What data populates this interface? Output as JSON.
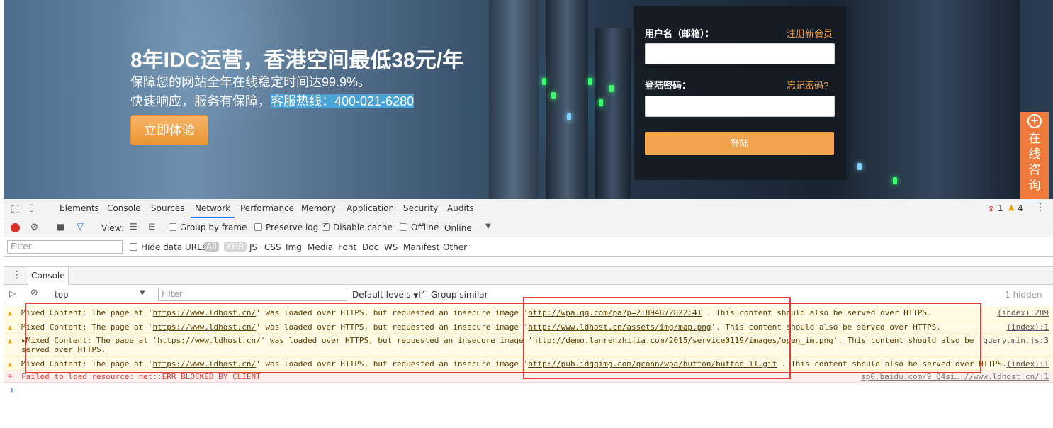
{
  "hero": {
    "title": "8年IDC运营，香港空间最低38元/年",
    "subtitle1": "保障您的网站全年在线稳定时间达99.9%。",
    "subtitle2_prefix": "快速响应，服务有保障，",
    "hotline": "客服热线：400-021-6280",
    "cta_label": "立即体验"
  },
  "login": {
    "username_label": "用户名（邮箱）：",
    "register_link": "注册新会员",
    "password_label": "登陆密码：",
    "forgot_link": "忘记密码?",
    "submit_label": "登陆"
  },
  "consult": {
    "chars": [
      "在",
      "线",
      "咨",
      "询"
    ]
  },
  "devtools": {
    "tabs": [
      "Elements",
      "Console",
      "Sources",
      "Network",
      "Performance",
      "Memory",
      "Application",
      "Security",
      "Audits"
    ],
    "active_tab": "Network",
    "error_count": "1",
    "warning_count": "4",
    "network_toolbar": {
      "view_label": "View:",
      "group_by_frame": "Group by frame",
      "preserve_log": "Preserve log",
      "disable_cache": "Disable cache",
      "offline": "Offline",
      "throttle": "Online"
    },
    "filter_bar": {
      "placeholder": "Filter",
      "hide_data_urls": "Hide data URLs",
      "types": [
        "All",
        "XHR",
        "JS",
        "CSS",
        "Img",
        "Media",
        "Font",
        "Doc",
        "WS",
        "Manifest",
        "Other"
      ]
    },
    "drawer": {
      "tab": "Console"
    },
    "console_toolbar": {
      "context": "top",
      "filter_placeholder": "Filter",
      "levels": "Default levels",
      "group_similar": "Group similar",
      "hidden": "1 hidden"
    },
    "messages": [
      {
        "type": "warning",
        "prefix": "Mixed Content: The page at '",
        "page": "https://www.ldhost.cn/",
        "mid": "' was loaded over HTTPS, but requested an insecure image  '",
        "url": "http://wpa.qq.com/pa?p=2:894872822:41",
        "suffix": "'. This content should also be served over HTTPS.",
        "source": "(index):289"
      },
      {
        "type": "warning",
        "prefix": "Mixed Content: The page at '",
        "page": "https://www.ldhost.cn/",
        "mid": "' was loaded over HTTPS, but requested an insecure image  '",
        "url": "http://www.ldhost.cn/assets/img/map.png",
        "suffix": "'. This content should also be served over HTTPS.",
        "source": "(index):1"
      },
      {
        "type": "warning",
        "prefix": "Mixed Content: The page at '",
        "page": "https://www.ldhost.cn/",
        "mid": "' was loaded over HTTPS, but requested an insecure image '",
        "url": "http://demo.lanrenzhijia.com/2015/service0119/images/open_im.png",
        "suffix": "'. This content should also be",
        "suffix2": "served over HTTPS.",
        "source": "jquery.min.js:3"
      },
      {
        "type": "warning",
        "prefix": "Mixed Content: The page at '",
        "page": "https://www.ldhost.cn/",
        "mid": "' was loaded over HTTPS, but requested an insecure image  '",
        "url": "http://pub.idqqimg.com/qconn/wpa/button/button_11.gif",
        "suffix": "'. This content should also be served over HTTPS.",
        "source": "(index):1"
      },
      {
        "type": "error",
        "text": "Failed to load resource: net::ERR_BLOCKED_BY_CLIENT",
        "source": "sp0.baidu.com/9_Q4si…://www.ldhost.cn/:1"
      }
    ],
    "prompt_symbol": "›"
  }
}
